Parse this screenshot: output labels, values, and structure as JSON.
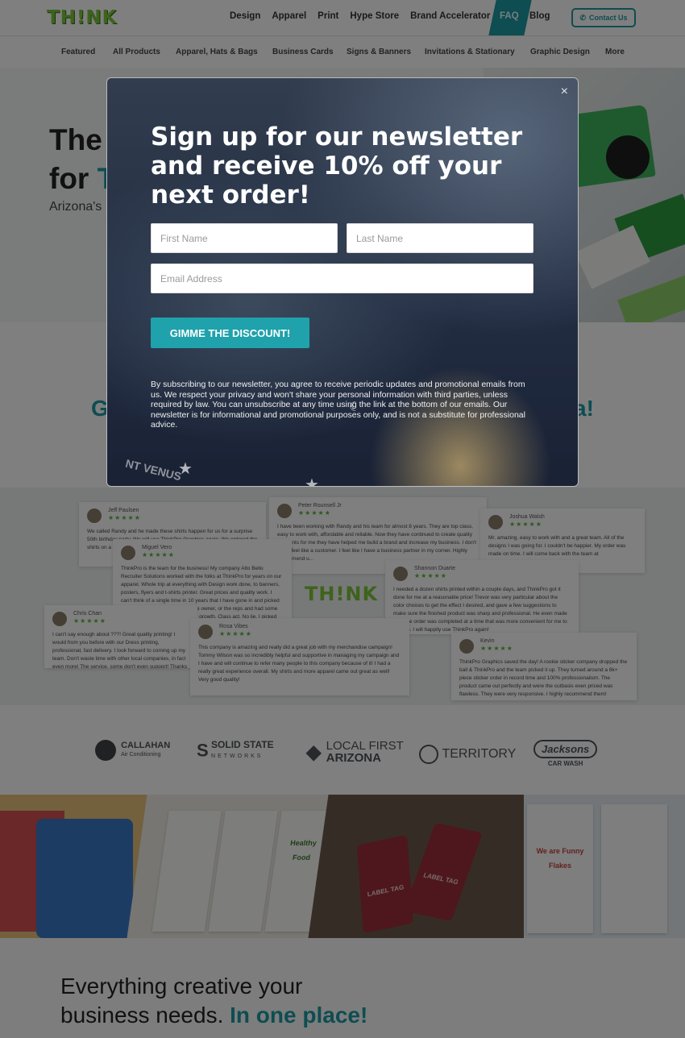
{
  "header": {
    "logo": "TH!NK",
    "main_nav": [
      "Design",
      "Apparel",
      "Print",
      "Hype Store",
      "Brand Accelerator"
    ],
    "faq": "FAQ",
    "blog": "Blog",
    "contact": "Contact Us",
    "sub_nav": [
      "Featured",
      "All Products",
      "Apparel, Hats & Bags",
      "Business Cards",
      "Signs & Banners",
      "Invitations & Stationary",
      "Graphic Design",
      "More"
    ]
  },
  "hero": {
    "title_line1": "The",
    "title_line2_start": "for",
    "sub": "Arizona's"
  },
  "reviews_heading": {
    "start": "G",
    "end": "a!"
  },
  "reviews": {
    "logo": "TH!NK",
    "cards": [
      {
        "name": "Jeff Paulsen",
        "stars": "★★★★★",
        "text": "We called Randy and he made these shirts happen for us for a surprise 50th birthday party. We will use ThinkPro Graphics again. We ordered the shirts on a Friday and th... and Outsta..."
      },
      {
        "name": "Peter Rounsell Jr",
        "stars": "★★★★★",
        "text": "I have been working with Randy and his team for almost 8 years. They are top class, easy to work with, affordable and reliable. Now they have continued to create quality garments for me they have helped me build a brand and increase my business. I don't really feel like a customer. I feel like I have a business partner in my corner. Highly recommend u..."
      },
      {
        "name": "Joshua Walsh",
        "stars": "★★★★★",
        "text": "Mr. amazing, easy to work with and a great team. All of the designs I was going for. I couldn't be happier. My order was made on time. I will come back with the team at"
      },
      {
        "name": "Miguel Vero",
        "stars": "★★★★★",
        "text": "ThinkPro is the team for the business! My company Alto Bello Recruiter Solutions worked with the folks at ThinkPro for years on our apparel. Whole trip at everything with Design work done, to banners, posters, flyers and t-shirts printer. Great prices and quality work. I can't think of a single time in 10 years that I have gone in and picked up my order and not asked for the owner, or the reps and had some laughs and talked small business growth. Class act. No lie, I picked up my few business cards from them today. Great customer service!! Support your local business, and call them up! T2 ThinkPro!"
      },
      {
        "name": "Shannon Duarte",
        "stars": "★★★★★",
        "text": "I needed a dozen shirts printed within a couple days, and ThinkPro got it done for me at a reasonable price! Trevor was very particular about the color choices to get the effect I desired, and gave a few suggestions to make sure the finished product was sharp and professional. He even made sure the order was completed at a time that was more convenient for me to pick up. I will happily use ThinkPro again!"
      },
      {
        "name": "Chris Chan",
        "stars": "★★★★★",
        "text": "I can't say enough about ???! Great quality printing! I would from you before with our Dress printing, professional, fast delivery. I look forward to coming up my team. Don't waste time with other local companies, in fact even more! The service, some don't even support! Thanks TP!"
      },
      {
        "name": "Rosa Vibes",
        "stars": "★★★★★",
        "text": "This company is amazing and really did a great job with my merchandise campaign! Tommy Wilson was so incredibly helpful and supportive in managing my campaign and I have and will continue to refer many people to this company because of it! I had a really great experience overall. My shirts and more apparel came out great as well! Very good quality!"
      },
      {
        "name": "Kevin",
        "stars": "★★★★★",
        "text": "ThinkPro Graphics saved the day! A rookie sticker company dropped the ball & ThinkPro and the team picked it up. They turned around a 8k+ piece sticker order in record time and 100% professionalism. The product came out perfectly and were the cutbasis even priced was flawless. They were very responsive. I highly recommend them!"
      }
    ]
  },
  "clients": {
    "callahan": "CALLAHAN",
    "callahan_sub": "Air Conditioning",
    "solidstate": "SOLID STATE",
    "solidstate_sub": "NETWORKS",
    "localfirst": "LOCAL FIRST",
    "localfirst_sub": "ARIZONA",
    "territory": "TERRITORY",
    "jacksons": "Jacksons",
    "jacksons_sub": "CAR WASH"
  },
  "showcase": {
    "healthy_food": "Healthy Food",
    "label_tag_1": "LABEL TAG",
    "label_tag_2": "LABEL TAG",
    "funny_flakes": "We are Funny Flakes"
  },
  "bottom": {
    "line1": "Everything creative your",
    "line2_start": "business needs.",
    "line2_accent": "In one place!"
  },
  "modal": {
    "title": "Sign up for our newsletter and receive 10% off your next order!",
    "first_name_placeholder": "First Name",
    "last_name_placeholder": "Last Name",
    "email_placeholder": "Email Address",
    "button": "GIMME THE DISCOUNT!",
    "close": "×",
    "disclaimer": "By subscribing to our newsletter, you agree to receive periodic updates and promotional emails from us. We respect your privacy and won't share your personal information with third parties, unless required by law. You can unsubscribe at any time using the link at the bottom of our emails. Our newsletter is for informational and promotional purposes only, and is not a substitute for professional advice.",
    "patch_text": "NT VENUS"
  },
  "colors": {
    "accent": "#1c9aa3",
    "brand_green": "#7cc63a",
    "button": "#1fa2ab",
    "overlay": "rgba(0,0,0,0.5)"
  }
}
